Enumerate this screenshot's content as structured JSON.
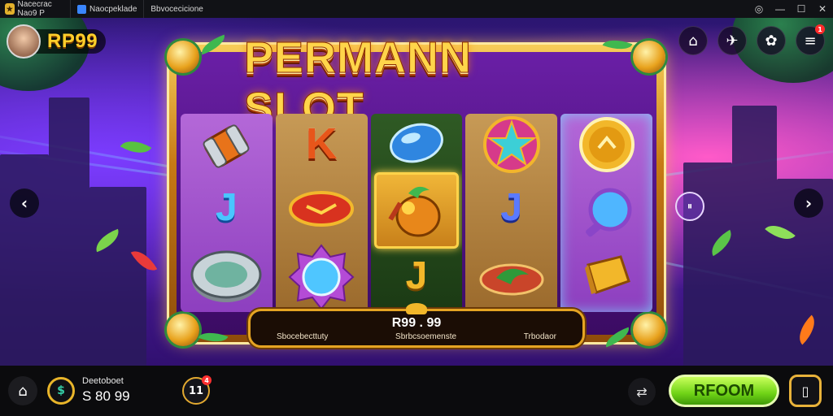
{
  "titlebar": {
    "app_name": "Nacecrac Nao9 P",
    "tab1_label": "Naocpeklade",
    "tab2_label": "Bbvocecicione",
    "controls": {
      "record": "⓫",
      "minimize": "—",
      "maximize": "☐",
      "close": "✕"
    }
  },
  "hud": {
    "balance": "RP99",
    "notification_count": "1"
  },
  "game": {
    "title": "PERMANN SLOT",
    "reels": [
      [
        "cylinder",
        "J",
        "coin-badge"
      ],
      [
        "K",
        "ruby-plaque",
        "star-gem"
      ],
      [
        "blue-gem",
        "fruit-wild",
        "J"
      ],
      [
        "star-medallion",
        "J",
        "leaf-plaque"
      ],
      [
        "gold-coin",
        "magnifier",
        "gold-chest"
      ]
    ],
    "info_value": "R99 . 99",
    "info_labels": [
      "Sbocebecttuty",
      "Sbrbcsoemenste",
      "Trbodaor"
    ],
    "pause_label": "⏸"
  },
  "bottom": {
    "balance_label": "Deetoboet",
    "balance_value": "S 80 99",
    "bet_label": "11",
    "bet_badge": "4",
    "spin_label": "RFOOM"
  },
  "colors": {
    "accent_gold": "#ffd54a",
    "spin_green": "#6fd316",
    "badge_red": "#ff2b2b"
  }
}
